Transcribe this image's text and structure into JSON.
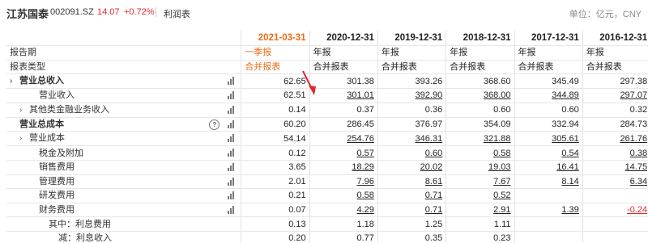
{
  "header": {
    "company": "江苏国泰",
    "code": "002091.SZ",
    "price": "14.07",
    "change": "+0.72%",
    "tab": "利润表",
    "unit": "单位：亿元，CNY"
  },
  "columns": [
    "2021-03-31",
    "2020-12-31",
    "2019-12-31",
    "2018-12-31",
    "2017-12-31",
    "2016-12-31",
    "2015-1"
  ],
  "report_period": [
    "一季报",
    "年报",
    "年报",
    "年报",
    "年报",
    "年报",
    "年"
  ],
  "report_type": [
    "合并报表",
    "合并报表",
    "合并报表",
    "合并报表",
    "合并报表",
    "合并报表",
    "合"
  ],
  "labels": {
    "period": "报告期",
    "type": "报表类型"
  },
  "rows": [
    {
      "label": "营业总收入",
      "indent": 0,
      "expand": true,
      "bold": true,
      "vals": [
        "62.65",
        "301.38",
        "393.26",
        "368.60",
        "345.49",
        "297.38",
        ""
      ]
    },
    {
      "label": "营业收入",
      "indent": 2,
      "expand": false,
      "bold": false,
      "vals": [
        "62.51",
        "301.01",
        "392.90",
        "368.00",
        "344.89",
        "297.07",
        ""
      ]
    },
    {
      "label": "其他类金融业务收入",
      "indent": 1,
      "expand": true,
      "bold": false,
      "vals": [
        "0.14",
        "0.37",
        "0.36",
        "0.60",
        "0.60",
        "0.32",
        ""
      ]
    },
    {
      "label": "营业总成本",
      "indent": 0,
      "expand": false,
      "bold": true,
      "vals": [
        "60.20",
        "286.45",
        "376.97",
        "354.09",
        "332.94",
        "284.73",
        ""
      ]
    },
    {
      "label": "营业成本",
      "indent": 1,
      "expand": true,
      "bold": false,
      "vals": [
        "54.14",
        "254.76",
        "346.31",
        "321.88",
        "305.61",
        "261.76",
        ""
      ]
    },
    {
      "label": "税金及附加",
      "indent": 2,
      "expand": false,
      "bold": false,
      "vals": [
        "0.12",
        "0.57",
        "0.60",
        "0.58",
        "0.54",
        "0.38",
        ""
      ]
    },
    {
      "label": "销售费用",
      "indent": 2,
      "expand": false,
      "bold": false,
      "vals": [
        "3.65",
        "18.29",
        "20.02",
        "19.03",
        "16.41",
        "14.75",
        ""
      ]
    },
    {
      "label": "管理费用",
      "indent": 2,
      "expand": false,
      "bold": false,
      "vals": [
        "2.01",
        "7.96",
        "8.61",
        "7.67",
        "8.14",
        "6.34",
        ""
      ]
    },
    {
      "label": "研发费用",
      "indent": 2,
      "expand": false,
      "bold": false,
      "vals": [
        "0.21",
        "0.58",
        "0.71",
        "0.52",
        "",
        "",
        " "
      ]
    },
    {
      "label": "财务费用",
      "indent": 2,
      "expand": false,
      "bold": false,
      "vals": [
        "0.07",
        "4.29",
        "0.71",
        "2.91",
        "1.39",
        "-0.24",
        ""
      ]
    },
    {
      "label": "其中：利息费用",
      "indent": 3,
      "expand": false,
      "bold": false,
      "vals": [
        "0.13",
        "1.18",
        "1.25",
        "1.11",
        "",
        "",
        ""
      ]
    },
    {
      "label": "减：利息收入",
      "indent": 4,
      "expand": false,
      "bold": false,
      "vals": [
        "0.20",
        "0.77",
        "0.35",
        "0.23",
        "",
        "",
        ""
      ]
    }
  ]
}
